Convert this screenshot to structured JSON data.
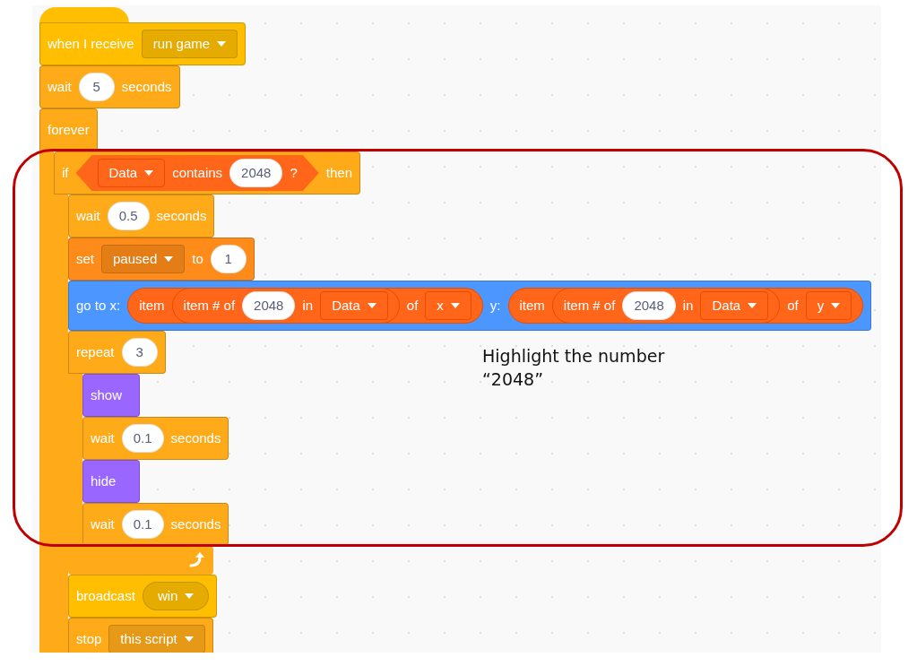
{
  "script": {
    "blocks": [
      {
        "kind": "hat",
        "color": "#ffbf00",
        "parts": [
          {
            "kind": "label",
            "text": "when I receive"
          },
          {
            "kind": "dropdown",
            "text": "run game"
          }
        ]
      },
      {
        "kind": "command",
        "color": "#ffab19",
        "parts": [
          {
            "kind": "label",
            "text": "wait"
          },
          {
            "kind": "number",
            "text": "5"
          },
          {
            "kind": "label",
            "text": "seconds"
          }
        ]
      },
      {
        "kind": "c-block",
        "color": "#ffab19",
        "parts": [
          {
            "kind": "label",
            "text": "forever"
          }
        ],
        "children": [
          {
            "kind": "c-block",
            "color": "#ffab19",
            "parts": [
              {
                "kind": "label",
                "text": "if"
              },
              {
                "kind": "boolean",
                "parts": [
                  {
                    "kind": "dropdown",
                    "text": "Data"
                  },
                  {
                    "kind": "label",
                    "text": "contains"
                  },
                  {
                    "kind": "number",
                    "text": "2048"
                  },
                  {
                    "kind": "label",
                    "text": "?"
                  }
                ]
              },
              {
                "kind": "label",
                "text": "then"
              }
            ],
            "children": [
              {
                "kind": "command",
                "color": "#ffab19",
                "parts": [
                  {
                    "kind": "label",
                    "text": "wait"
                  },
                  {
                    "kind": "number",
                    "text": "0.5"
                  },
                  {
                    "kind": "label",
                    "text": "seconds"
                  }
                ]
              },
              {
                "kind": "command",
                "color": "#ff8c1a",
                "parts": [
                  {
                    "kind": "label",
                    "text": "set"
                  },
                  {
                    "kind": "dropdown",
                    "text": "paused"
                  },
                  {
                    "kind": "label",
                    "text": "to"
                  },
                  {
                    "kind": "number",
                    "text": "1"
                  }
                ]
              },
              {
                "kind": "command",
                "color": "#4c97ff",
                "parts": [
                  {
                    "kind": "label",
                    "text": "go to x:"
                  },
                  {
                    "kind": "reporter",
                    "parts": [
                      {
                        "kind": "label",
                        "text": "item"
                      },
                      {
                        "kind": "reporter",
                        "parts": [
                          {
                            "kind": "label",
                            "text": "item # of"
                          },
                          {
                            "kind": "number",
                            "text": "2048"
                          },
                          {
                            "kind": "label",
                            "text": "in"
                          },
                          {
                            "kind": "dropdown",
                            "text": "Data"
                          }
                        ]
                      },
                      {
                        "kind": "label",
                        "text": "of"
                      },
                      {
                        "kind": "dropdown",
                        "text": "x"
                      }
                    ]
                  },
                  {
                    "kind": "label",
                    "text": "y:"
                  },
                  {
                    "kind": "reporter",
                    "parts": [
                      {
                        "kind": "label",
                        "text": "item"
                      },
                      {
                        "kind": "reporter",
                        "parts": [
                          {
                            "kind": "label",
                            "text": "item # of"
                          },
                          {
                            "kind": "number",
                            "text": "2048"
                          },
                          {
                            "kind": "label",
                            "text": "in"
                          },
                          {
                            "kind": "dropdown",
                            "text": "Data"
                          }
                        ]
                      },
                      {
                        "kind": "label",
                        "text": "of"
                      },
                      {
                        "kind": "dropdown",
                        "text": "y"
                      }
                    ]
                  }
                ]
              },
              {
                "kind": "c-block",
                "color": "#ffab19",
                "parts": [
                  {
                    "kind": "label",
                    "text": "repeat"
                  },
                  {
                    "kind": "number",
                    "text": "3"
                  }
                ],
                "footer": {
                  "kind": "loop"
                },
                "children": [
                  {
                    "kind": "command",
                    "color": "#9966ff",
                    "parts": [
                      {
                        "kind": "label",
                        "text": "show"
                      }
                    ]
                  },
                  {
                    "kind": "command",
                    "color": "#ffab19",
                    "parts": [
                      {
                        "kind": "label",
                        "text": "wait"
                      },
                      {
                        "kind": "number",
                        "text": "0.1"
                      },
                      {
                        "kind": "label",
                        "text": "seconds"
                      }
                    ]
                  },
                  {
                    "kind": "command",
                    "color": "#9966ff",
                    "parts": [
                      {
                        "kind": "label",
                        "text": "hide"
                      }
                    ]
                  },
                  {
                    "kind": "command",
                    "color": "#ffab19",
                    "parts": [
                      {
                        "kind": "label",
                        "text": "wait"
                      },
                      {
                        "kind": "number",
                        "text": "0.1"
                      },
                      {
                        "kind": "label",
                        "text": "seconds"
                      }
                    ]
                  }
                ]
              },
              {
                "kind": "command",
                "color": "#ffbf00",
                "parts": [
                  {
                    "kind": "label",
                    "text": "broadcast"
                  },
                  {
                    "kind": "round-dropdown",
                    "text": "win"
                  }
                ]
              },
              {
                "kind": "command",
                "color": "#ffab19",
                "parts": [
                  {
                    "kind": "label",
                    "text": "stop"
                  },
                  {
                    "kind": "dropdown",
                    "text": "this script"
                  }
                ]
              }
            ]
          }
        ]
      }
    ]
  },
  "annotation": {
    "text": "Highlight the number “2048”"
  }
}
